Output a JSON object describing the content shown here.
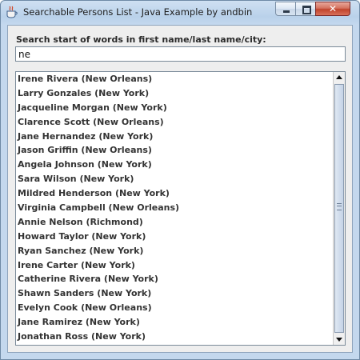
{
  "window": {
    "title": "Searchable Persons List - Java Example by andbin",
    "icons": {
      "app": "java-cup-icon",
      "minimize": "minimize-icon",
      "maximize": "maximize-icon",
      "close": "close-icon"
    },
    "close_glyph": "✕"
  },
  "search": {
    "label": "Search start of words in first name/last name/city:",
    "value": "ne"
  },
  "persons": [
    "Irene Rivera (New Orleans)",
    "Larry Gonzales (New York)",
    "Jacqueline Morgan (New York)",
    "Clarence Scott (New Orleans)",
    "Jane Hernandez (New York)",
    "Jason Griffin (New Orleans)",
    "Angela Johnson (New York)",
    "Sara Wilson (New York)",
    "Mildred Henderson (New York)",
    "Virginia Campbell (New Orleans)",
    "Annie Nelson (Richmond)",
    "Howard Taylor (New York)",
    "Ryan Sanchez (New York)",
    "Irene Carter (New York)",
    "Catherine Rivera (New York)",
    "Shawn Sanders (New York)",
    "Evelyn Cook (New Orleans)",
    "Jane Ramirez (New York)",
    "Jonathan Ross (New York)"
  ],
  "colors": {
    "title_bar": "#b9d1ea",
    "close_button": "#c0442c",
    "panel_background": "#eeeeee",
    "list_text": "#333333"
  }
}
